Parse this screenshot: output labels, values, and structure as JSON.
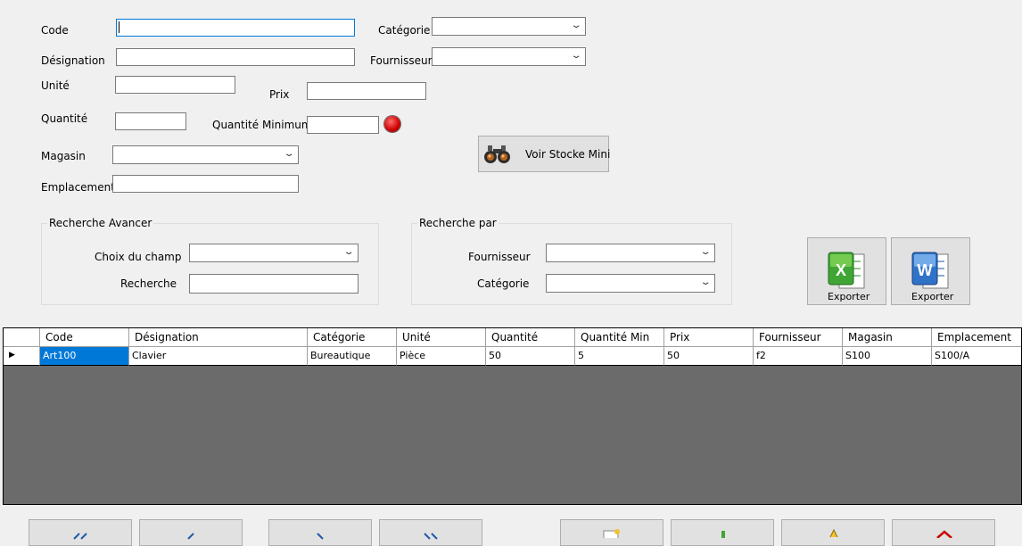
{
  "form": {
    "code_label": "Code",
    "designation_label": "Désignation",
    "unite_label": "Unité",
    "prix_label": "Prix",
    "quantite_label": "Quantité",
    "quantite_min_label": "Quantité Minimum",
    "magasin_label": "Magasin",
    "emplacement_label": "Emplacement",
    "categorie_label": "Catégorie",
    "fournisseur_label": "Fournisseur",
    "voir_stock_label": "Voir Stocke Mini",
    "stock_indicator_color": "#cc0000"
  },
  "search_advanced": {
    "title": "Recherche Avancer",
    "champ_label": "Choix du champ",
    "recherche_label": "Recherche"
  },
  "search_by": {
    "title": "Recherche par",
    "fournisseur_label": "Fournisseur",
    "categorie_label": "Catégorie"
  },
  "export": {
    "excel_label": "Exporter",
    "word_label": "Exporter",
    "excel_color": "#2e8b2e",
    "word_color": "#1e5aa8"
  },
  "grid": {
    "columns": [
      "Code",
      "Désignation",
      "Catégorie",
      "Unité",
      "Quantité",
      "Quantité Min",
      "Prix",
      "Fournisseur",
      "Magasin",
      "Emplacement"
    ],
    "rows": [
      [
        "Art100",
        "Clavier",
        "Bureautique",
        "Pièce",
        "50",
        "5",
        "50",
        "f2",
        "S100",
        "S100/A"
      ]
    ],
    "row_marker": "▶",
    "selection_color": "#0078d7",
    "empty_area_color": "#6b6b6b"
  }
}
